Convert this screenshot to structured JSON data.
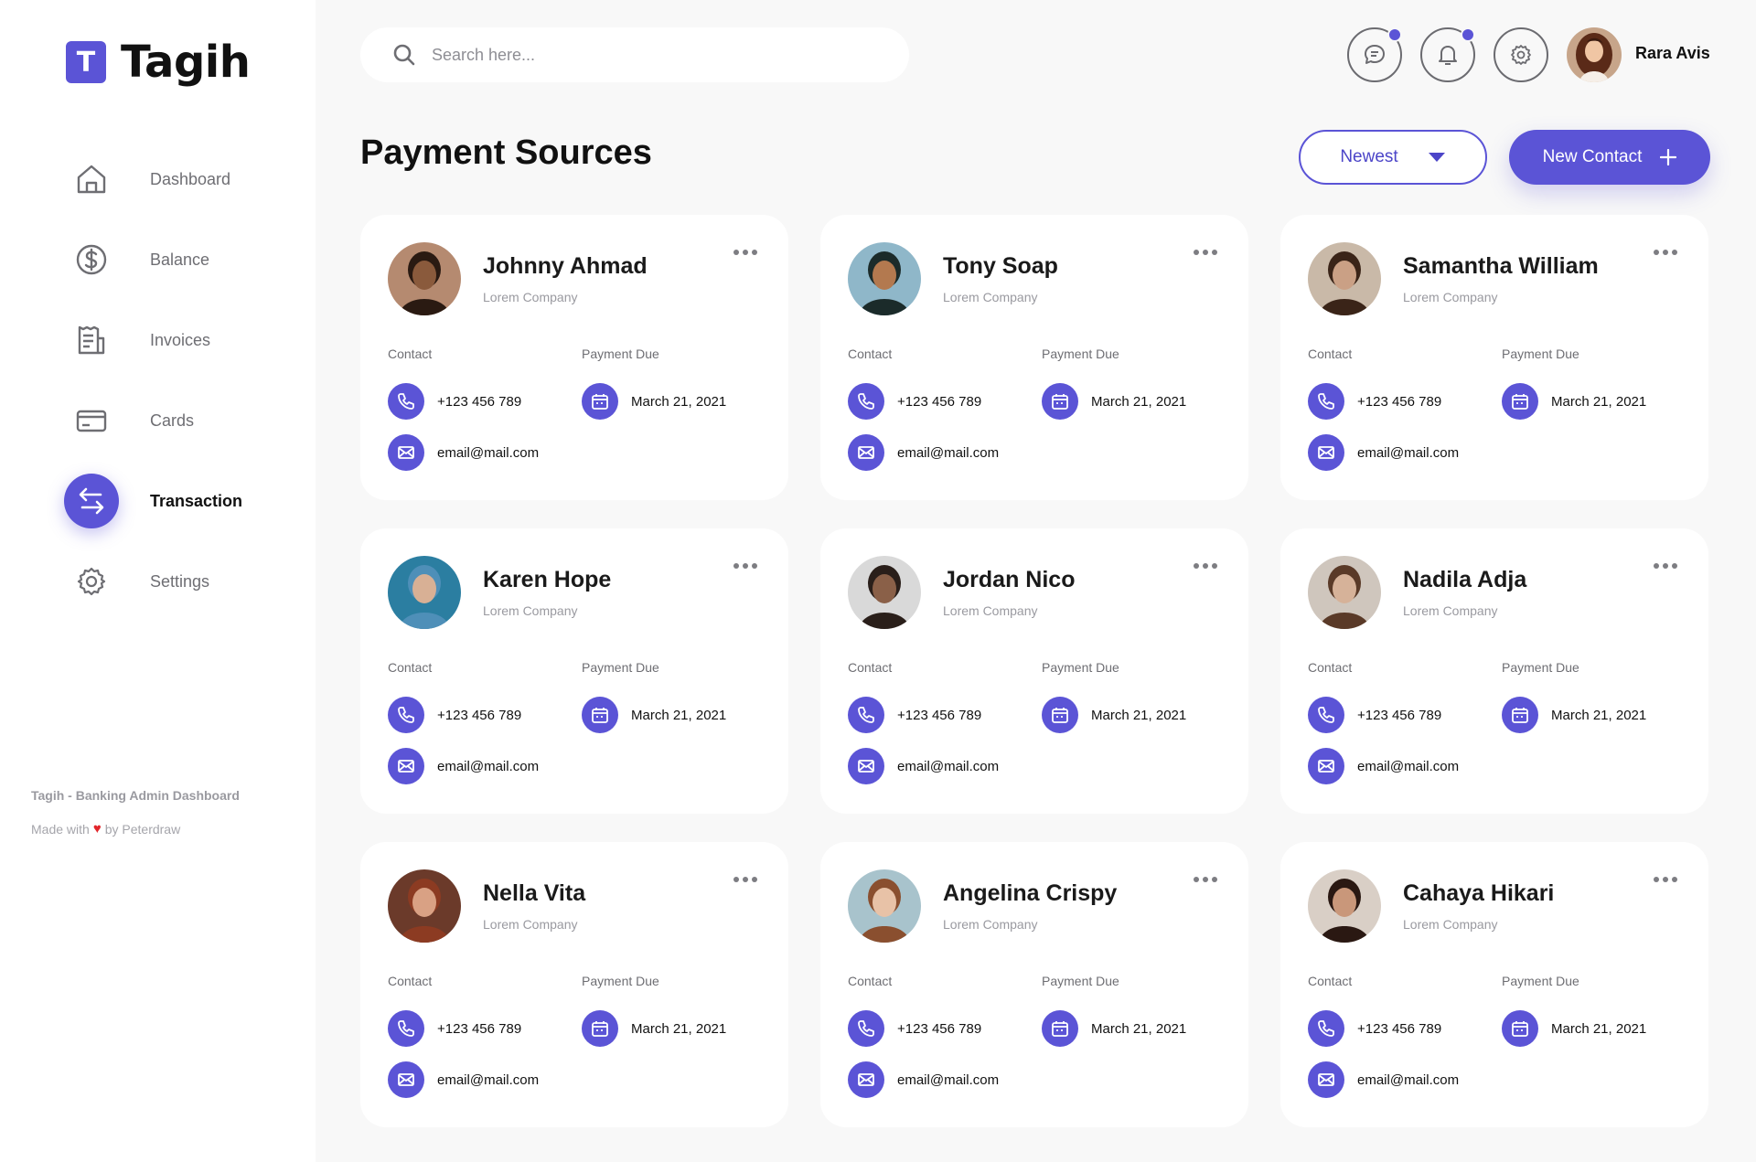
{
  "brand": {
    "mark": "T",
    "name": "Tagih",
    "accent": "#5b54d6"
  },
  "sidebar": {
    "items": [
      {
        "label": "Dashboard",
        "icon": "home-icon",
        "active": false
      },
      {
        "label": "Balance",
        "icon": "dollar-circle-icon",
        "active": false
      },
      {
        "label": "Invoices",
        "icon": "invoice-icon",
        "active": false
      },
      {
        "label": "Cards",
        "icon": "credit-card-icon",
        "active": false
      },
      {
        "label": "Transaction",
        "icon": "transfer-arrows-icon",
        "active": true
      },
      {
        "label": "Settings",
        "icon": "gear-icon",
        "active": false
      }
    ],
    "footer_title": "Tagih - Banking Admin Dashboard",
    "footer_made_prefix": "Made with",
    "footer_made_suffix": "by Peterdraw"
  },
  "header": {
    "search_placeholder": "Search here...",
    "icons": [
      "chat-icon",
      "bell-icon",
      "gear-icon"
    ],
    "user_name": "Rara Avis"
  },
  "main": {
    "title": "Payment Sources",
    "sort_label": "Newest",
    "new_button_label": "New Contact",
    "contact_label": "Contact",
    "due_label": "Payment Due",
    "cards": [
      {
        "name": "Johnny Ahmad",
        "company": "Lorem Company",
        "phone": "+123 456 789",
        "due": "March 21, 2021",
        "email": "email@mail.com"
      },
      {
        "name": "Tony Soap",
        "company": "Lorem Company",
        "phone": "+123 456 789",
        "due": "March 21, 2021",
        "email": "email@mail.com"
      },
      {
        "name": "Samantha William",
        "company": "Lorem Company",
        "phone": "+123 456 789",
        "due": "March 21, 2021",
        "email": "email@mail.com"
      },
      {
        "name": "Karen Hope",
        "company": "Lorem Company",
        "phone": "+123 456 789",
        "due": "March 21, 2021",
        "email": "email@mail.com"
      },
      {
        "name": "Jordan Nico",
        "company": "Lorem Company",
        "phone": "+123 456 789",
        "due": "March 21, 2021",
        "email": "email@mail.com"
      },
      {
        "name": "Nadila Adja",
        "company": "Lorem Company",
        "phone": "+123 456 789",
        "due": "March 21, 2021",
        "email": "email@mail.com"
      },
      {
        "name": "Nella Vita",
        "company": "Lorem Company",
        "phone": "+123 456 789",
        "due": "March 21, 2021",
        "email": "email@mail.com"
      },
      {
        "name": "Angelina Crispy",
        "company": "Lorem Company",
        "phone": "+123 456 789",
        "due": "March 21, 2021",
        "email": "email@mail.com"
      },
      {
        "name": "Cahaya Hikari",
        "company": "Lorem Company",
        "phone": "+123 456 789",
        "due": "March 21, 2021",
        "email": "email@mail.com"
      }
    ]
  }
}
